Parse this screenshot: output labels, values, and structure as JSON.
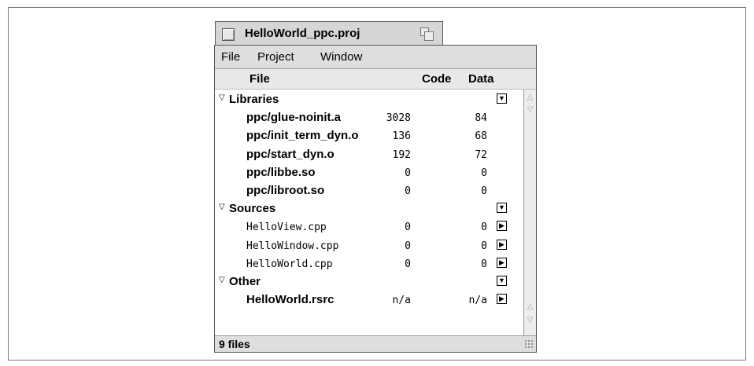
{
  "window": {
    "title": "HelloWorld_ppc.proj"
  },
  "menu": [
    "File",
    "Project",
    "Window"
  ],
  "columns": {
    "file": "File",
    "code": "Code",
    "data": "Data"
  },
  "groups": [
    {
      "label": "Libraries",
      "files": [
        {
          "name": "ppc/glue-noinit.a",
          "code": "3028",
          "data": "84",
          "style": "bold"
        },
        {
          "name": "ppc/init_term_dyn.o",
          "code": "136",
          "data": "68",
          "style": "bold"
        },
        {
          "name": "ppc/start_dyn.o",
          "code": "192",
          "data": "72",
          "style": "bold"
        },
        {
          "name": "ppc/libbe.so",
          "code": "0",
          "data": "0",
          "style": "bold"
        },
        {
          "name": "ppc/libroot.so",
          "code": "0",
          "data": "0",
          "style": "bold"
        }
      ]
    },
    {
      "label": "Sources",
      "files": [
        {
          "name": "HelloView.cpp",
          "code": "0",
          "data": "0",
          "style": "mono"
        },
        {
          "name": "HelloWindow.cpp",
          "code": "0",
          "data": "0",
          "style": "mono"
        },
        {
          "name": "HelloWorld.cpp",
          "code": "0",
          "data": "0",
          "style": "mono"
        }
      ]
    },
    {
      "label": "Other",
      "files": [
        {
          "name": "HelloWorld.rsrc",
          "code": "n/a",
          "data": "n/a",
          "style": "bold"
        }
      ]
    }
  ],
  "status": {
    "text": "9 files"
  },
  "icons": {
    "expanded": "disclosure-triangle-down",
    "group_control": "popup-menu-icon",
    "file_control": "arrow-right-icon"
  }
}
